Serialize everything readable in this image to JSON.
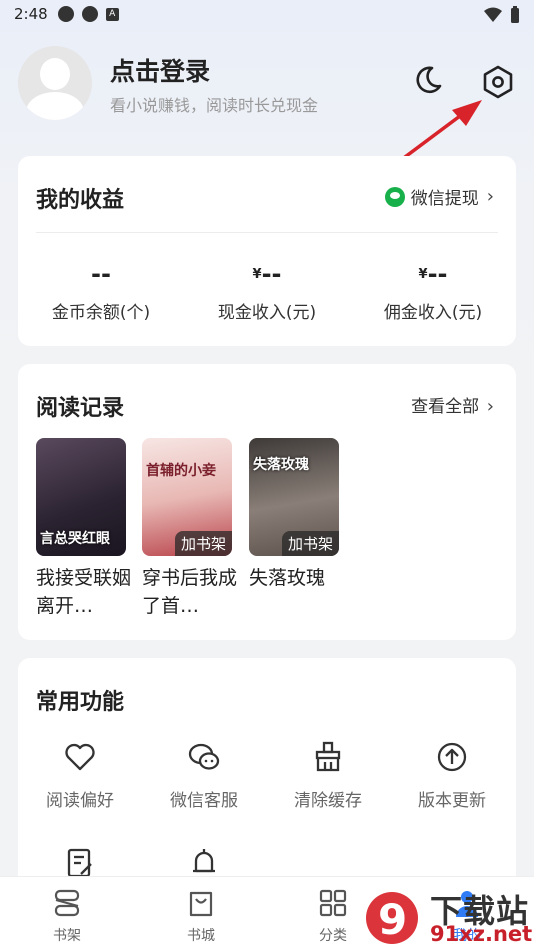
{
  "status_bar": {
    "time": "2:48",
    "notif_letter": "A"
  },
  "profile": {
    "title": "点击登录",
    "subtitle": "看小说赚钱，阅读时长兑现金"
  },
  "earnings": {
    "title": "我的收益",
    "withdraw_label": "微信提现",
    "stats": [
      {
        "value": "--",
        "prefix": "",
        "label": "金币余额(个)"
      },
      {
        "value": "--",
        "prefix": "¥",
        "label": "现金收入(元)"
      },
      {
        "value": "--",
        "prefix": "¥",
        "label": "佣金收入(元)"
      }
    ]
  },
  "records": {
    "title": "阅读记录",
    "see_all": "查看全部",
    "books": [
      {
        "title": "我接受联姻离开…",
        "tag": "",
        "cover_text": "言总哭红眼",
        "cover_color": "#3a2e3c"
      },
      {
        "title": "穿书后我成了首…",
        "tag": "加书架",
        "cover_text": "首辅的小妾",
        "cover_color": "#f0d6d6"
      },
      {
        "title": "失落玫瑰",
        "tag": "加书架",
        "cover_text": "失落玫瑰",
        "cover_color": "#6b6560"
      }
    ]
  },
  "functions": {
    "title": "常用功能",
    "items": [
      {
        "label": "阅读偏好",
        "icon": "heart-icon"
      },
      {
        "label": "微信客服",
        "icon": "wechat-icon"
      },
      {
        "label": "清除缓存",
        "icon": "broom-icon"
      },
      {
        "label": "版本更新",
        "icon": "upload-cloud-icon"
      },
      {
        "label": "",
        "icon": "note-edit-icon"
      },
      {
        "label": "",
        "icon": "bell-icon"
      }
    ]
  },
  "tabbar": {
    "items": [
      {
        "label": "书架",
        "icon": "bookshelf-icon"
      },
      {
        "label": "书城",
        "icon": "bag-icon"
      },
      {
        "label": "分类",
        "icon": "grid-icon"
      },
      {
        "label": "我的",
        "icon": "user-icon"
      }
    ]
  },
  "watermark": {
    "logo_text": "9",
    "line1": "下载站",
    "line2": "91xz.net"
  },
  "colors": {
    "wechat_green": "#18b04a",
    "arrow_red": "#d8232a",
    "accent_blue": "#2f7cf6"
  }
}
